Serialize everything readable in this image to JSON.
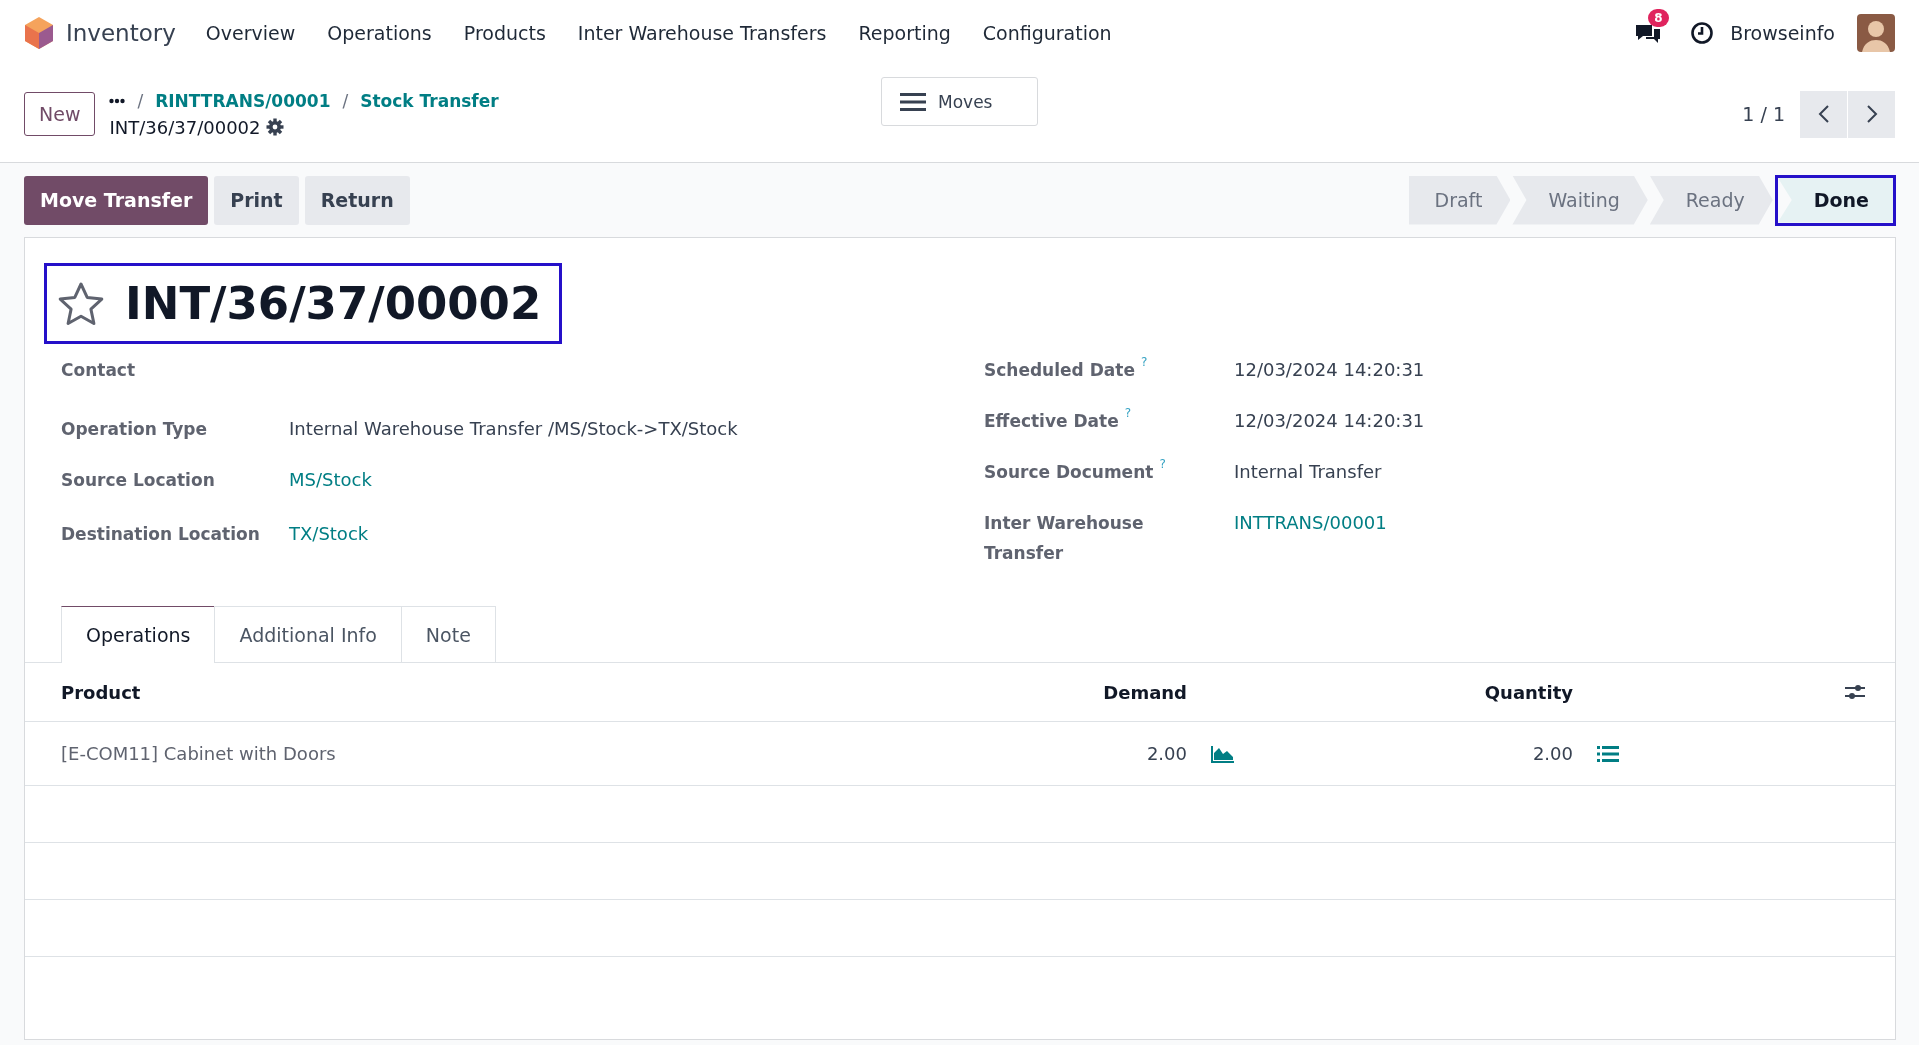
{
  "navbar": {
    "app_name": "Inventory",
    "menu": [
      "Overview",
      "Operations",
      "Products",
      "Inter Warehouse Transfers",
      "Reporting",
      "Configuration"
    ],
    "notification_count": "8",
    "user_name": "Browseinfo"
  },
  "control_panel": {
    "new_button": "New",
    "breadcrumbs": [
      {
        "separator": "/",
        "label": "RINTTRANS/00001"
      },
      {
        "separator": "/",
        "label": "Stock Transfer"
      }
    ],
    "record_name": "INT/36/37/00002",
    "moves_button": "Moves",
    "pager": "1 / 1"
  },
  "actions": [
    {
      "label": "Move Transfer",
      "kind": "primary"
    },
    {
      "label": "Print",
      "kind": "secondary"
    },
    {
      "label": "Return",
      "kind": "secondary"
    }
  ],
  "stages": [
    {
      "label": "Draft",
      "selected": false
    },
    {
      "label": "Waiting",
      "selected": false
    },
    {
      "label": "Ready",
      "selected": false
    },
    {
      "label": "Done",
      "selected": true
    }
  ],
  "title": {
    "text": "INT/36/37/00002",
    "favorite": false
  },
  "fields_left": [
    {
      "label": "Contact",
      "kind": "empty"
    },
    {
      "label": "Operation Type",
      "value": "Internal Warehouse Transfer /MS/Stock->TX/Stock",
      "kind": "text"
    },
    {
      "label": "Source Location",
      "value": "MS/Stock",
      "kind": "link"
    },
    {
      "label": "Destination Location",
      "value": "TX/Stock",
      "kind": "link"
    }
  ],
  "fields_right": [
    {
      "label": "Scheduled Date",
      "help": "?",
      "value": "12/03/2024 14:20:31",
      "kind": "text"
    },
    {
      "label": "Effective Date",
      "help": "?",
      "value": "12/03/2024 14:20:31",
      "kind": "text"
    },
    {
      "label": "Source Document",
      "help": "?",
      "value": "Internal Transfer",
      "kind": "text"
    },
    {
      "label": "Inter Warehouse Transfer",
      "value": "INTTRANS/00001",
      "kind": "link"
    }
  ],
  "tabs": [
    {
      "label": "Operations",
      "selected": true
    },
    {
      "label": "Additional Info",
      "selected": false
    },
    {
      "label": "Note",
      "selected": false
    }
  ],
  "table": {
    "columns": [
      "Product",
      "Demand",
      "Quantity"
    ],
    "rows": [
      {
        "product": "[E-COM11] Cabinet with Doors",
        "demand": "2.00",
        "quantity": "2.00"
      }
    ]
  }
}
